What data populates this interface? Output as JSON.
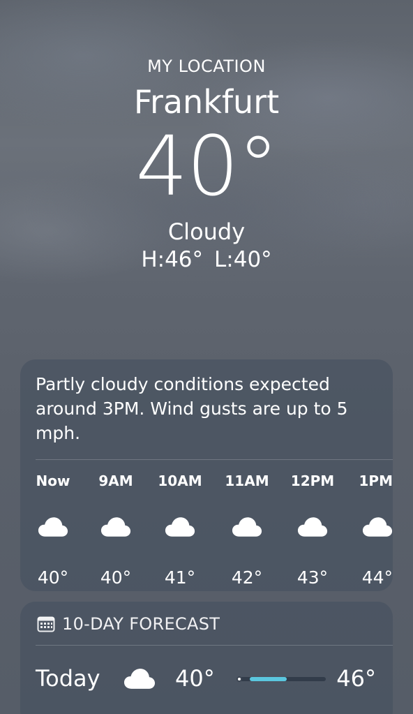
{
  "header": {
    "location_label": "MY LOCATION",
    "city": "Frankfurt",
    "temperature": "40°",
    "condition": "Cloudy",
    "high": "H:46°",
    "low": "L:40°"
  },
  "hourly": {
    "summary": "Partly cloudy conditions expected around 3PM. Wind gusts are up to 5 mph.",
    "hours": [
      {
        "label": "Now",
        "icon": "cloud-icon",
        "temp": "40°"
      },
      {
        "label": "9AM",
        "icon": "cloud-icon",
        "temp": "40°"
      },
      {
        "label": "10AM",
        "icon": "cloud-icon",
        "temp": "41°"
      },
      {
        "label": "11AM",
        "icon": "cloud-icon",
        "temp": "42°"
      },
      {
        "label": "12PM",
        "icon": "cloud-icon",
        "temp": "43°"
      },
      {
        "label": "1PM",
        "icon": "cloud-icon",
        "temp": "44°"
      }
    ]
  },
  "forecast": {
    "title": "10-DAY FORECAST",
    "icon": "calendar-icon",
    "days": [
      {
        "day": "Today",
        "icon": "cloud-icon",
        "low": "40°",
        "high": "46°",
        "range_start": 0.15,
        "range_end": 0.56,
        "current": 0.0
      }
    ]
  },
  "colors": {
    "range_bar": "#5bc6de"
  }
}
